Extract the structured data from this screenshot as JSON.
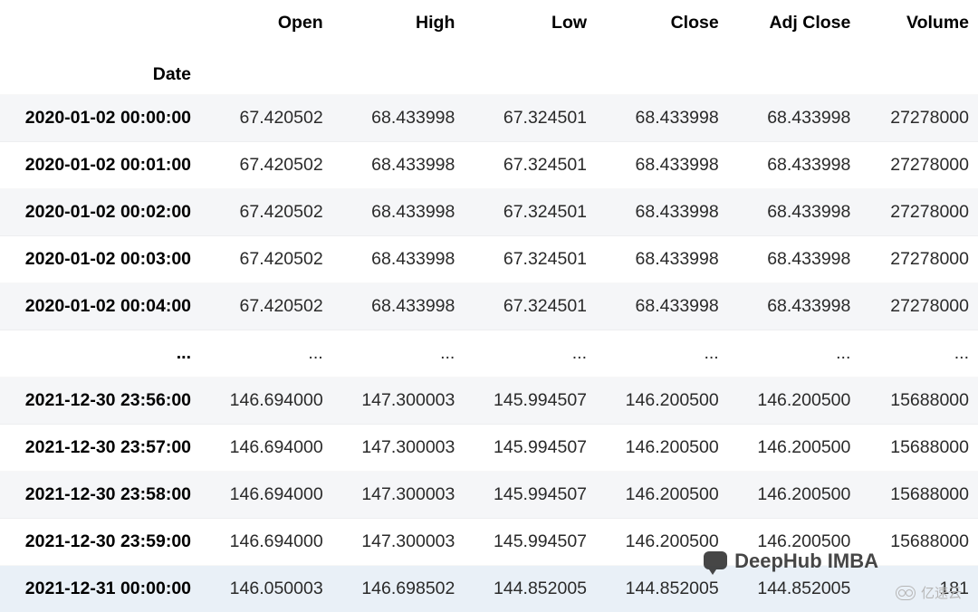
{
  "table": {
    "index_label": "Date",
    "columns": [
      "Open",
      "High",
      "Low",
      "Close",
      "Adj Close",
      "Volume"
    ],
    "rows": [
      {
        "index": "2020-01-02 00:00:00",
        "values": [
          "67.420502",
          "68.433998",
          "67.324501",
          "68.433998",
          "68.433998",
          "27278000"
        ]
      },
      {
        "index": "2020-01-02 00:01:00",
        "values": [
          "67.420502",
          "68.433998",
          "67.324501",
          "68.433998",
          "68.433998",
          "27278000"
        ]
      },
      {
        "index": "2020-01-02 00:02:00",
        "values": [
          "67.420502",
          "68.433998",
          "67.324501",
          "68.433998",
          "68.433998",
          "27278000"
        ]
      },
      {
        "index": "2020-01-02 00:03:00",
        "values": [
          "67.420502",
          "68.433998",
          "67.324501",
          "68.433998",
          "68.433998",
          "27278000"
        ]
      },
      {
        "index": "2020-01-02 00:04:00",
        "values": [
          "67.420502",
          "68.433998",
          "67.324501",
          "68.433998",
          "68.433998",
          "27278000"
        ]
      },
      {
        "index": "...",
        "values": [
          "...",
          "...",
          "...",
          "...",
          "...",
          "..."
        ],
        "ellipsis": true
      },
      {
        "index": "2021-12-30 23:56:00",
        "values": [
          "146.694000",
          "147.300003",
          "145.994507",
          "146.200500",
          "146.200500",
          "15688000"
        ]
      },
      {
        "index": "2021-12-30 23:57:00",
        "values": [
          "146.694000",
          "147.300003",
          "145.994507",
          "146.200500",
          "146.200500",
          "15688000"
        ]
      },
      {
        "index": "2021-12-30 23:58:00",
        "values": [
          "146.694000",
          "147.300003",
          "145.994507",
          "146.200500",
          "146.200500",
          "15688000"
        ]
      },
      {
        "index": "2021-12-30 23:59:00",
        "values": [
          "146.694000",
          "147.300003",
          "145.994507",
          "146.200500",
          "146.200500",
          "15688000"
        ]
      },
      {
        "index": "2021-12-31 00:00:00",
        "values": [
          "146.050003",
          "146.698502",
          "144.852005",
          "144.852005",
          "144.852005",
          "181"
        ],
        "highlight": true
      }
    ]
  },
  "overlay": {
    "text": "DeepHub IMBA"
  },
  "watermark": {
    "text": "亿速云"
  }
}
